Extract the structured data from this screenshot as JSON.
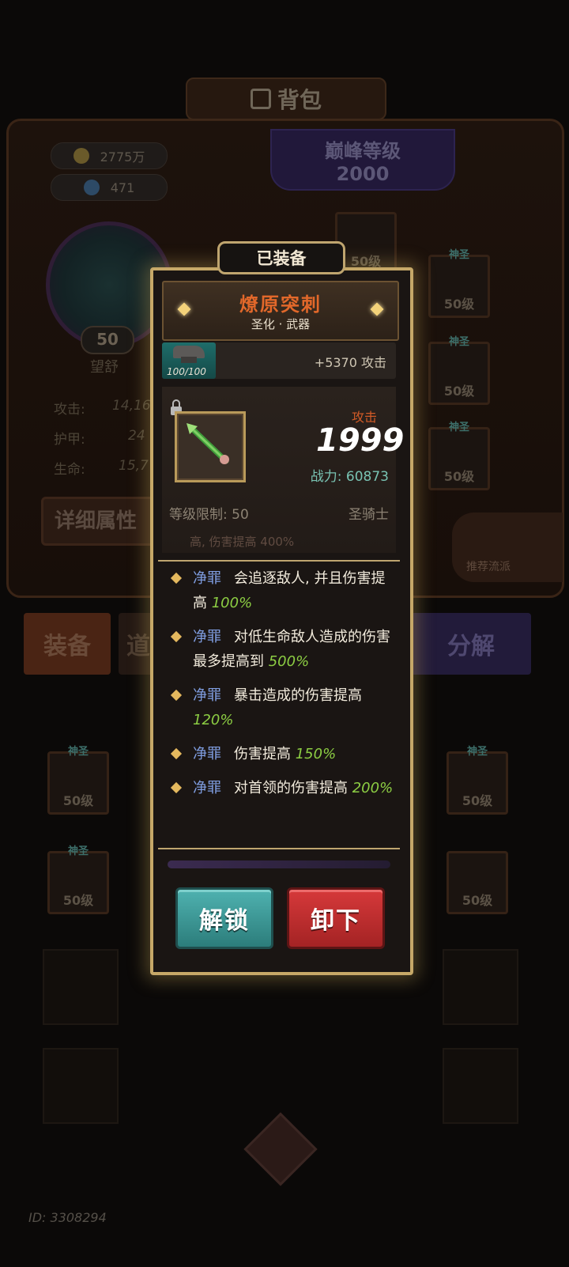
{
  "background": {
    "title": "背包",
    "gold": "2775万",
    "gems": "471",
    "peak_label": "巅峰等级",
    "peak_value": "2000",
    "hero_level": "50",
    "hero_name": "望舒",
    "stats": [
      {
        "label": "攻击:",
        "value": "14,16"
      },
      {
        "label": "护甲:",
        "value": "24"
      },
      {
        "label": "生命:",
        "value": "15,7"
      }
    ],
    "detail_button": "详细属性",
    "tabs": [
      "装备",
      "道",
      "分解"
    ],
    "slot_tag": "神圣",
    "slot_level": "50级",
    "recommend": "推荐流派",
    "user_id": "ID: 3308294"
  },
  "modal": {
    "equipped_tag": "已装备",
    "item_name": "燎原突刺",
    "item_subtitle": "圣化 · 武器",
    "forge_progress": "100/100",
    "forge_bonus": "+5370 攻击",
    "attack_label": "攻击",
    "attack_value": "1999",
    "power_text": "战力: 60873",
    "level_req": "等级限制: 50",
    "class_req": "圣骑士",
    "cutoff_text": "高, 伤害提高 400%",
    "effects": [
      {
        "keyword": "净罪",
        "text": "会追逐敌人, 并且伤害提高",
        "percent": "100%"
      },
      {
        "keyword": "净罪",
        "text": "对低生命敌人造成的伤害最多提高到",
        "percent": "500%"
      },
      {
        "keyword": "净罪",
        "text": "暴击造成的伤害提高",
        "percent": "120%"
      },
      {
        "keyword": "净罪",
        "text": "伤害提高",
        "percent": "150%"
      },
      {
        "keyword": "净罪",
        "text": "对首领的伤害提高",
        "percent": "200%"
      }
    ],
    "unlock_button": "解锁",
    "unequip_button": "卸下"
  },
  "colors": {
    "modal_border": "#c6a868",
    "item_name": "#e2682a",
    "keyword": "#7f9de0",
    "percent": "#8ccd43",
    "unlock": "#3a9795",
    "unequip": "#c02d2e"
  }
}
